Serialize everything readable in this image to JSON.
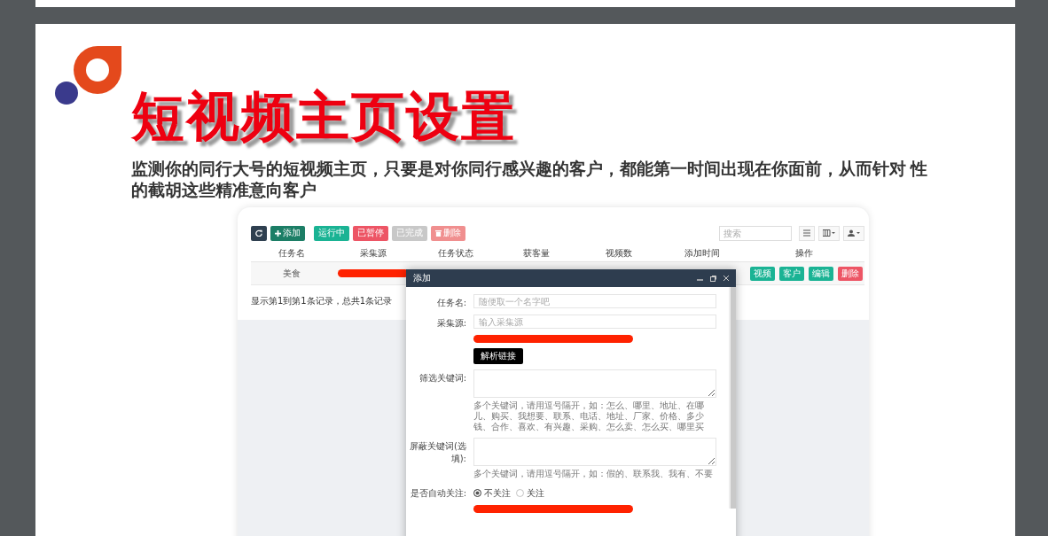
{
  "slide": {
    "title": "短视频主页设置",
    "paragraph": "监测你的同行大号的短视频主页，只要是对你同行感兴趣的客户，都能第一时间出现在你面前，从而针对 性的截胡这些精准意向客户"
  },
  "app": {
    "toolbar": [
      {
        "kind": "refresh",
        "color": "#2f4050"
      },
      {
        "kind": "add",
        "label": "添加",
        "color": "#1c7e66"
      },
      {
        "kind": "plain",
        "label": "运行中",
        "color": "#1ab394"
      },
      {
        "kind": "plain",
        "label": "已暂停",
        "color": "#ed5565"
      },
      {
        "kind": "plain",
        "label": "已完成",
        "color": "#c8c8c8"
      },
      {
        "kind": "delete",
        "label": "删除",
        "color": "#f08f8f"
      }
    ],
    "search": {
      "placeholder": "搜索"
    },
    "table": {
      "columns": [
        "任务名",
        "采集源",
        "任务状态",
        "获客量",
        "视频数",
        "添加时间",
        "操作"
      ],
      "rows": [
        {
          "cells": [
            {
              "kind": "text",
              "text": "美食"
            },
            {
              "kind": "redacted"
            }
          ],
          "actions": [
            {
              "label": "视频",
              "color": "#1ab394"
            },
            {
              "label": "客户",
              "color": "#1ab394"
            },
            {
              "label": "编辑",
              "color": "#1ab394"
            },
            {
              "label": "删除",
              "color": "#ed5565"
            }
          ]
        }
      ]
    },
    "pagination": "显示第1到第1条记录，总共1条记录",
    "modal": {
      "title": "添加",
      "fields": [
        {
          "kind": "input",
          "label": "任务名:",
          "placeholder": "随便取一个名字吧"
        },
        {
          "kind": "input",
          "label": "采集源:",
          "placeholder": "输入采集源"
        },
        {
          "kind": "redacted"
        },
        {
          "kind": "button",
          "label": "解析链接"
        },
        {
          "kind": "textarea",
          "label": "筛选关键词:",
          "help": "多个关键词，请用逗号隔开，如：怎么、哪里、地址、在哪儿、购买、我想要、联系、电话、地址、厂家、价格、多少钱、合作、喜欢、有兴趣、采购、怎么卖、怎么买、哪里买"
        },
        {
          "kind": "textarea",
          "label": "屏蔽关键词(选填):",
          "help": "多个关键词，请用逗号隔开，如：假的、联系我、我有、不要"
        },
        {
          "kind": "radio",
          "label": "是否自动关注:",
          "options": [
            {
              "label": "不关注",
              "selected": true
            },
            {
              "label": "关注",
              "selected": false
            }
          ]
        },
        {
          "kind": "redacted"
        }
      ]
    }
  }
}
